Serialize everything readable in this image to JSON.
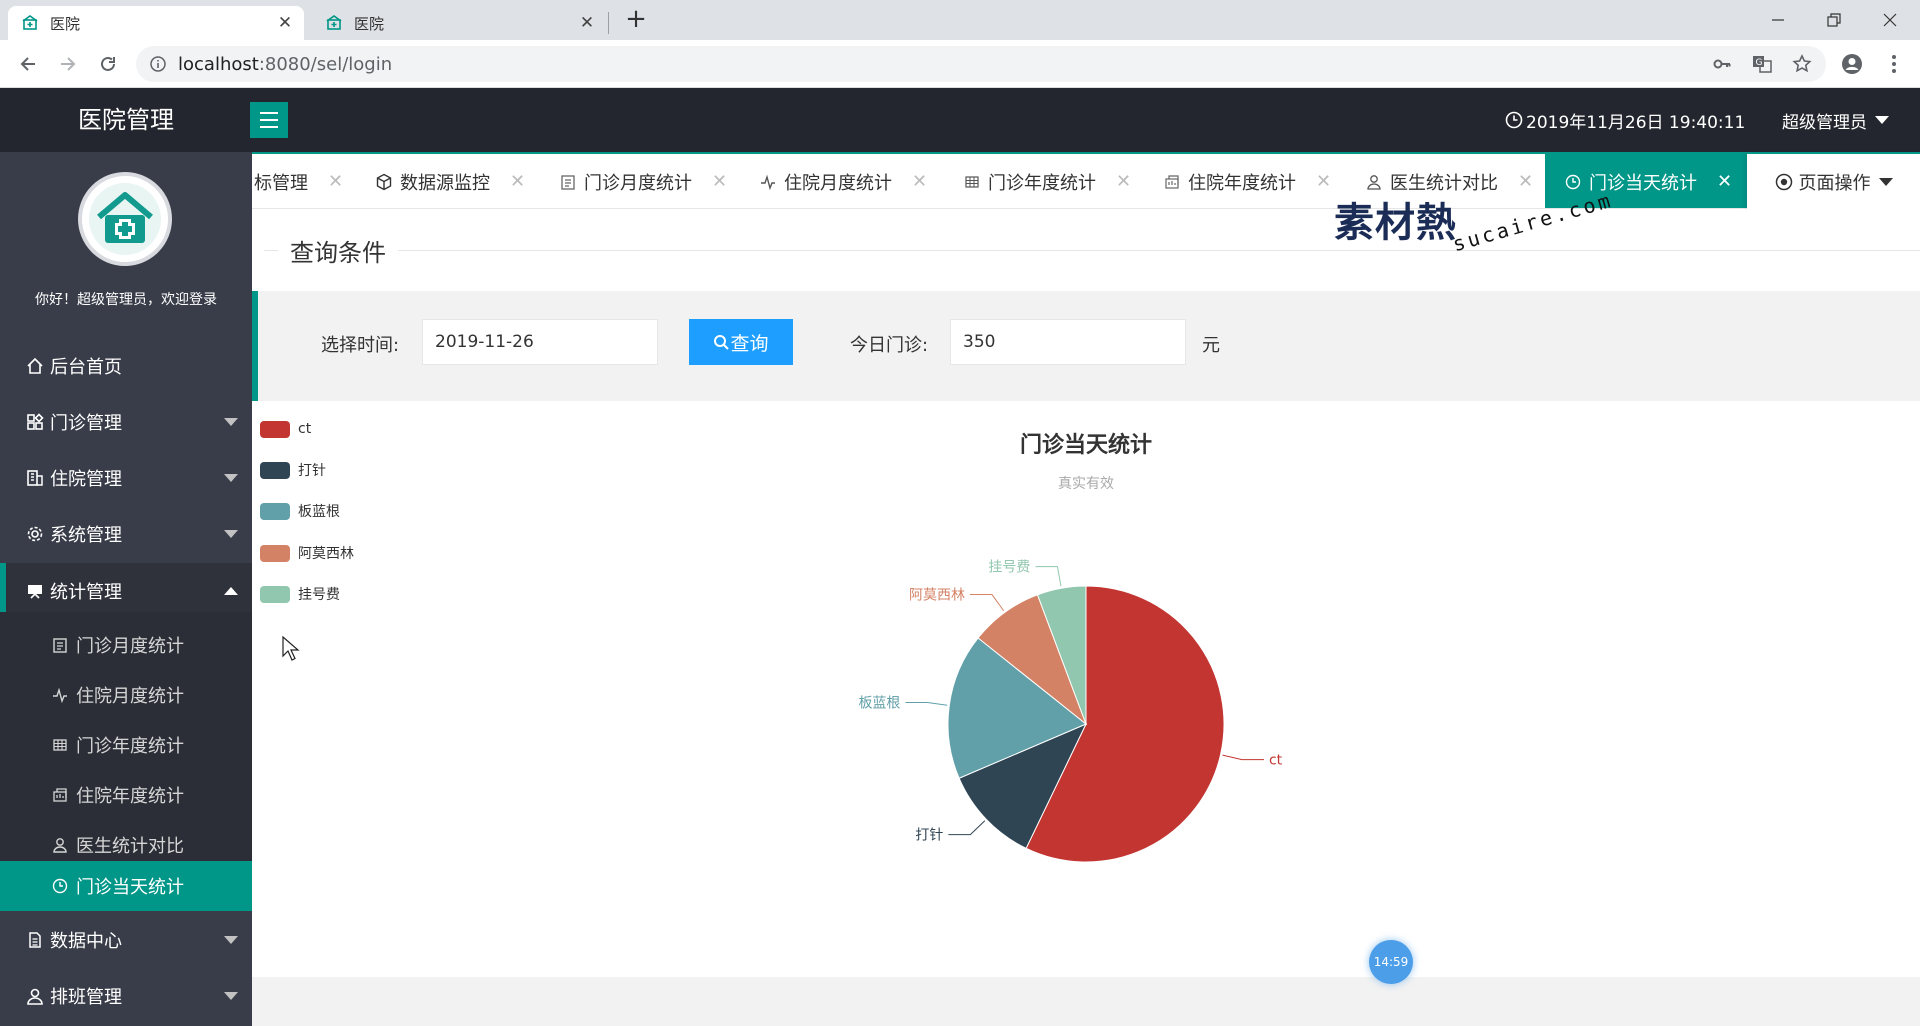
{
  "browser": {
    "tabs": [
      {
        "title": "医院",
        "active": true
      },
      {
        "title": "医院",
        "active": false
      }
    ],
    "url_host": "localhost",
    "url_rest": ":8080/sel/login"
  },
  "header": {
    "title": "医院管理",
    "datetime": "2019年11月26日 19:40:11",
    "user": "超级管理员"
  },
  "sidebar": {
    "welcome": "你好！超级管理员，欢迎登录",
    "items": [
      {
        "label": "后台首页",
        "icon": "home-icon"
      },
      {
        "label": "门诊管理",
        "icon": "apps-icon"
      },
      {
        "label": "住院管理",
        "icon": "building-icon"
      },
      {
        "label": "系统管理",
        "icon": "gear-icon"
      },
      {
        "label": "统计管理",
        "icon": "chart-board-icon"
      },
      {
        "label": "数据中心",
        "icon": "document-icon"
      },
      {
        "label": "排班管理",
        "icon": "user-icon"
      }
    ],
    "subitems": [
      {
        "label": "门诊月度统计",
        "icon": "clipboard-icon"
      },
      {
        "label": "住院月度统计",
        "icon": "pulse-icon"
      },
      {
        "label": "门诊年度统计",
        "icon": "grid-icon"
      },
      {
        "label": "住院年度统计",
        "icon": "report-icon"
      },
      {
        "label": "医生统计对比",
        "icon": "user-icon"
      },
      {
        "label": "门诊当天统计",
        "icon": "clock-icon"
      }
    ]
  },
  "content_tabs": [
    {
      "label": "标管理",
      "icon": ""
    },
    {
      "label": "数据源监控",
      "icon": "cube-icon"
    },
    {
      "label": "门诊月度统计",
      "icon": "clipboard-icon"
    },
    {
      "label": "住院月度统计",
      "icon": "pulse-icon"
    },
    {
      "label": "门诊年度统计",
      "icon": "grid-icon"
    },
    {
      "label": "住院年度统计",
      "icon": "report-icon"
    },
    {
      "label": "医生统计对比",
      "icon": "user-icon"
    },
    {
      "label": "门诊当天统计",
      "icon": "clock-icon"
    }
  ],
  "page_ops": "页面操作",
  "query": {
    "legend": "查询条件",
    "date_label": "选择时间:",
    "date_value": "2019-11-26",
    "search_button": "查询",
    "today_label": "今日门诊:",
    "today_value": "350",
    "unit": "元"
  },
  "watermark": {
    "main": "素材熱",
    "sub": "sucaire.com"
  },
  "timer": "14:59",
  "colors": {
    "accent": "#009688",
    "button_blue": "#1e9fff",
    "sidebar": "#393d49",
    "header": "#23262e"
  },
  "chart_data": {
    "type": "pie",
    "title": "门诊当天统计",
    "subtitle": "真实有效",
    "legend_position": "top-left",
    "slices": [
      {
        "name": "ct",
        "value": 200,
        "color": "#c23531"
      },
      {
        "name": "打针",
        "value": 40,
        "color": "#2f4554"
      },
      {
        "name": "板蓝根",
        "value": 60,
        "color": "#61a0a8"
      },
      {
        "name": "阿莫西林",
        "value": 30,
        "color": "#d48265"
      },
      {
        "name": "挂号费",
        "value": 20,
        "color": "#91c7ae"
      }
    ]
  }
}
